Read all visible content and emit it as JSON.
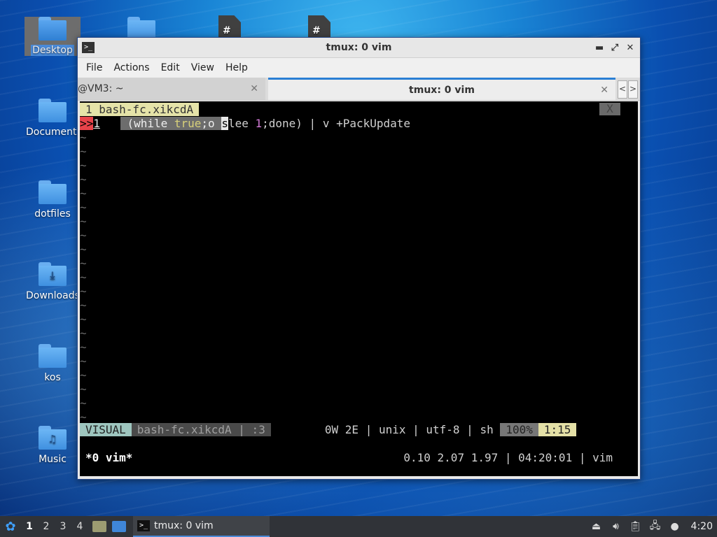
{
  "desktop": {
    "icons": [
      {
        "label": "Desktop",
        "glyph": ""
      },
      {
        "label": "Documents",
        "glyph": ""
      },
      {
        "label": "dotfiles",
        "glyph": ""
      },
      {
        "label": "Downloads",
        "glyph": "⤓"
      },
      {
        "label": "kos",
        "glyph": ""
      },
      {
        "label": "Music",
        "glyph": "♫"
      }
    ],
    "top_files": [
      "#",
      "#"
    ]
  },
  "window": {
    "title": "tmux: 0 vim",
    "icon": "terminal-icon",
    "controls": [
      "▬",
      "⤢",
      "✕"
    ],
    "menu": [
      "File",
      "Actions",
      "Edit",
      "View",
      "Help"
    ],
    "tabs": [
      {
        "label": "@VM3: ~",
        "close": "✕"
      },
      {
        "label": "tmux: 0 vim",
        "close": "✕"
      }
    ],
    "tab_scroll": [
      "<",
      ">"
    ]
  },
  "terminal": {
    "buffer_tab": "1 bash-fc.xikcdA",
    "buffer_close": "X",
    "line": {
      "prompt": ">>",
      "number": "1",
      "sel_open": " (while ",
      "keyword": "true",
      "sel_tail": ";o ",
      "cursor_char": "s",
      "after_cursor": "lee ",
      "number_arg": "1",
      "rest": ";done) | v +PackUpdate"
    },
    "tilde": "~",
    "status": {
      "mode": "VISUAL",
      "file": "bash-fc.xikcdA | :3",
      "info": "0W 2E | unix | utf-8 | sh",
      "percent": "100%",
      "position": "1:15"
    },
    "tmux": {
      "left": "*0 vim*",
      "right": "0.10 2.07 1.97 | 04:20:01 | vim"
    }
  },
  "taskbar": {
    "workspaces": [
      "1",
      "2",
      "3",
      "4"
    ],
    "active_workspace": "1",
    "task_label": "tmux: 0 vim",
    "clock": "4:20"
  }
}
